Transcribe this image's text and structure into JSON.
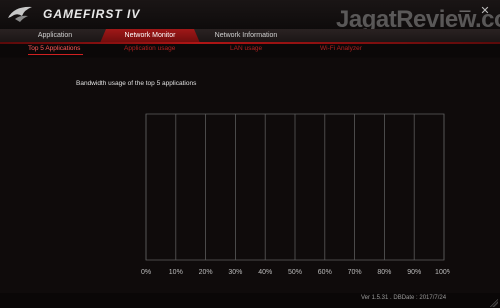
{
  "app": {
    "title": "GAMEFIRST IV",
    "logo_icon": "rog-eye-icon",
    "watermark": "JagatReview.com",
    "window_controls": {
      "minimize": "—",
      "close": "✕"
    }
  },
  "tabs": [
    {
      "label": "Application",
      "active": false
    },
    {
      "label": "Network Monitor",
      "active": true
    },
    {
      "label": "Network Information",
      "active": false
    }
  ],
  "subtabs": [
    {
      "label": "Top 5 Applications",
      "active": true
    },
    {
      "label": "Application usage",
      "active": false
    },
    {
      "label": "LAN usage",
      "active": false
    },
    {
      "label": "Wi-Fi Analyzer",
      "active": false
    }
  ],
  "chart_data": {
    "type": "bar",
    "title": "Bandwidth usage of the top 5 applications",
    "categories": [],
    "values": [],
    "xlabel": "",
    "ylabel": "",
    "xlim": [
      0,
      100
    ],
    "xticks": [
      "0%",
      "10%",
      "20%",
      "30%",
      "40%",
      "50%",
      "60%",
      "70%",
      "80%",
      "90%",
      "100%"
    ],
    "grid": true,
    "orientation": "horizontal"
  },
  "footer": {
    "version": "Ver 1.5.31 . DBDate : 2017/7/24"
  },
  "colors": {
    "accent": "#b01515",
    "subtab_text": "#b02020",
    "subtab_active": "#ff5a5a",
    "background": "#0f0b0b",
    "grid": "#5a5a5a"
  }
}
